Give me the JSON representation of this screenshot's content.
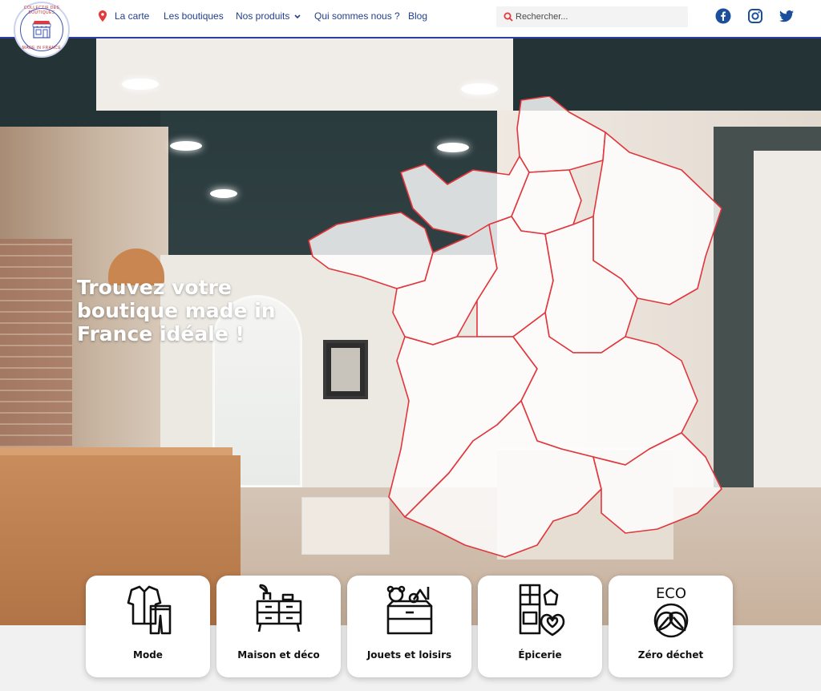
{
  "logo": {
    "top_text": "COLLECTIF DES BOUTIQUES",
    "bottom_text": "MADE IN FRANCE"
  },
  "nav": {
    "items": [
      {
        "label": "La carte",
        "icon": "map-pin-icon"
      },
      {
        "label": "Les boutiques"
      },
      {
        "label": "Nos produits",
        "icon": "chevron-down-icon"
      },
      {
        "label": "Qui sommes nous ?"
      },
      {
        "label": "Blog"
      }
    ],
    "search": {
      "placeholder": "Rechercher...",
      "value": ""
    },
    "social": [
      "facebook-icon",
      "instagram-icon",
      "twitter-icon"
    ]
  },
  "hero": {
    "title": "Trouvez votre boutique made in France idéale !"
  },
  "categories": [
    {
      "label": "Mode",
      "icon": "clothing-icon"
    },
    {
      "label": "Maison et déco",
      "icon": "furniture-icon"
    },
    {
      "label": "Jouets et loisirs",
      "icon": "toys-icon"
    },
    {
      "label": "Épicerie",
      "icon": "grocery-icon"
    },
    {
      "label": "Zéro déchet",
      "icon": "eco-leaf-icon",
      "icon_text": "ECO"
    }
  ],
  "colors": {
    "nav_text": "#23408e",
    "accent_red": "#e53935",
    "brand_blue": "#2a3ea0",
    "social_blue": "#1b4f9c"
  }
}
